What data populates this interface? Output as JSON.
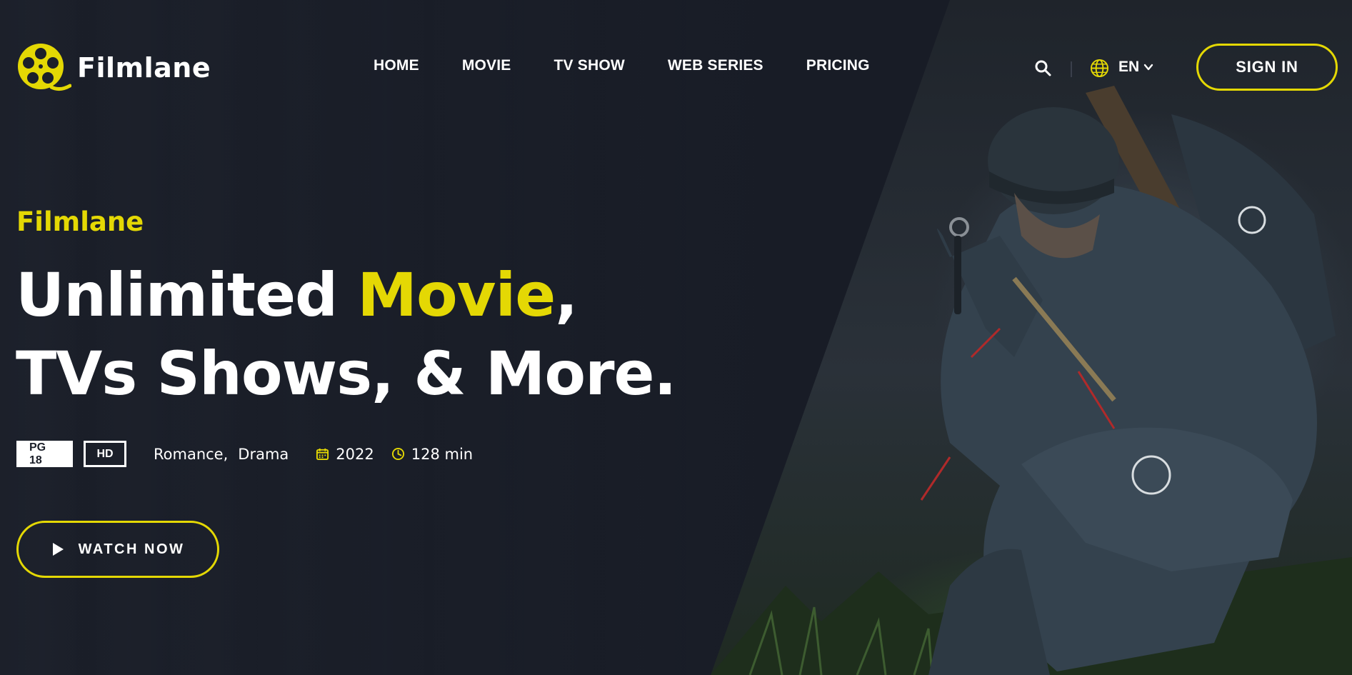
{
  "brand": {
    "name": "Filmlane",
    "accent_color": "#e4d804"
  },
  "nav": {
    "items": [
      {
        "label": "HOME"
      },
      {
        "label": "MOVIE"
      },
      {
        "label": "TV SHOW"
      },
      {
        "label": "WEB SERIES"
      },
      {
        "label": "PRICING"
      }
    ]
  },
  "header": {
    "search_icon": "search-icon",
    "language_icon": "globe-icon",
    "language": "EN",
    "sign_in_label": "SIGN IN"
  },
  "hero": {
    "subtitle": "Filmlane",
    "headline_part1": "Unlimited ",
    "headline_accent": "Movie",
    "headline_part2": ",",
    "headline_line2": "TVs Shows, & More.",
    "badge_rating": "PG 18",
    "badge_quality": "HD",
    "genres": [
      "Romance,",
      "Drama"
    ],
    "year": "2022",
    "duration": "128 min",
    "watch_now_label": "WATCH NOW"
  }
}
